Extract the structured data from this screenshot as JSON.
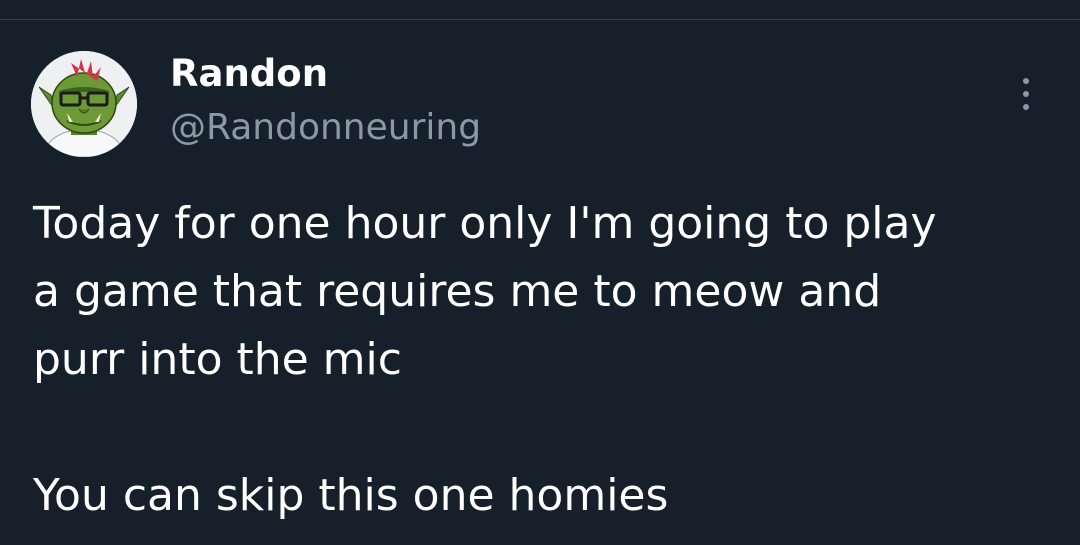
{
  "tweet": {
    "author": {
      "display_name": "Randon",
      "handle": "@Randonneuring",
      "avatar_icon": "orc-avatar-icon"
    },
    "more_icon": "more-options-icon",
    "text_lines": [
      "Today for one hour only I'm going to play",
      "a game that requires me to meow and",
      "purr into the mic"
    ],
    "text_lines_2": [
      "You can skip this one homies"
    ]
  },
  "colors": {
    "background": "#15202b",
    "primary_text": "#ffffff",
    "secondary_text": "#8b98a5",
    "divider": "#38444d"
  }
}
